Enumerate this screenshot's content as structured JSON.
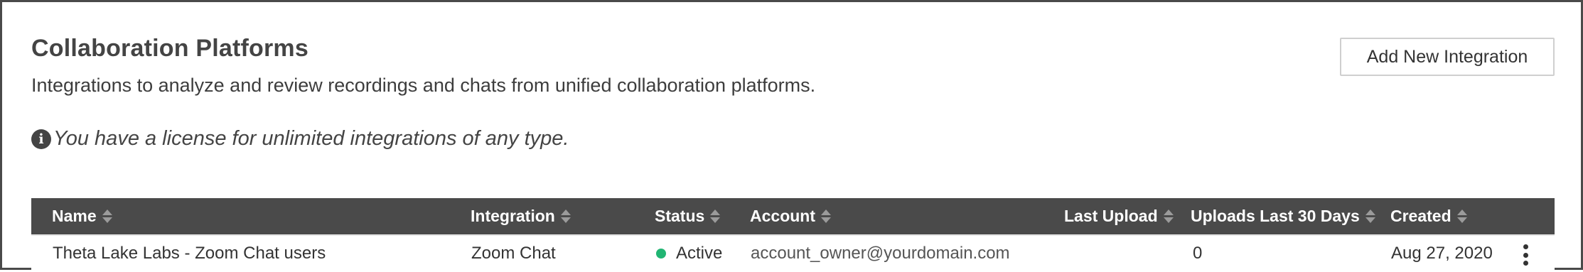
{
  "header": {
    "title": "Collaboration Platforms",
    "subtitle": "Integrations to analyze and review recordings and chats from unified collaboration platforms.",
    "license_icon": "info-circle-icon",
    "license_text": "You have a license for unlimited integrations of any type.",
    "add_button_label": "Add New Integration"
  },
  "table": {
    "columns": [
      {
        "key": "name",
        "label": "Name",
        "sortable": true
      },
      {
        "key": "integration",
        "label": "Integration",
        "sortable": true
      },
      {
        "key": "status",
        "label": "Status",
        "sortable": true
      },
      {
        "key": "account",
        "label": "Account",
        "sortable": true
      },
      {
        "key": "last_upload",
        "label": "Last Upload",
        "sortable": true
      },
      {
        "key": "uploads_30",
        "label": "Uploads Last 30 Days",
        "sortable": true
      },
      {
        "key": "created",
        "label": "Created",
        "sortable": true
      }
    ],
    "rows": [
      {
        "name": "Theta Lake Labs - Zoom Chat users",
        "integration": "Zoom Chat",
        "status": "Active",
        "account": "account_owner@yourdomain.com",
        "last_upload": "",
        "uploads_30": "0",
        "created": "Aug 27, 2020",
        "actions_icon": "more-vertical-icon"
      }
    ]
  },
  "colors": {
    "header_bg": "#4a4a4a",
    "status_active": "#21b573",
    "border": "#cfcfcf"
  }
}
